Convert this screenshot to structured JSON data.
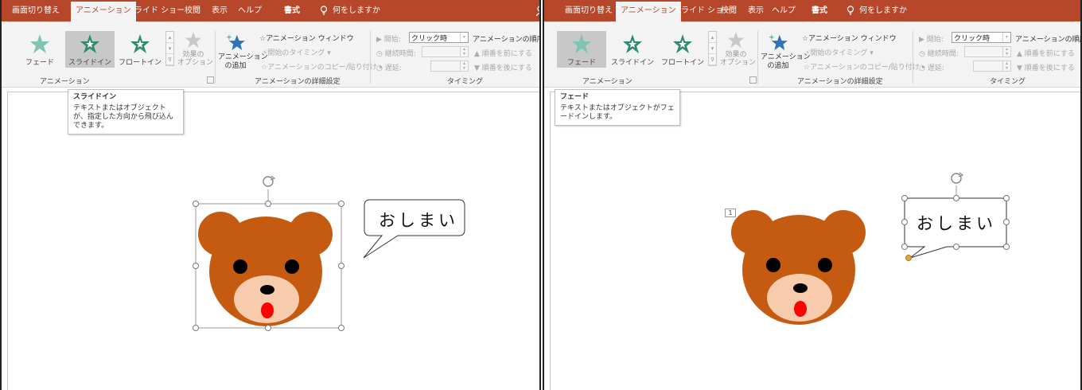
{
  "colors": {
    "accent": "#b7472a",
    "bear_fur": "#c55a11",
    "bear_muzzle": "#f8cbad",
    "tongue": "#ff0000"
  },
  "left": {
    "tabs": [
      "画面切り替え",
      "アニメーション",
      "スライド ショー",
      "校閲",
      "表示",
      "ヘルプ",
      "書式"
    ],
    "active_tab": "アニメーション",
    "tell_me": "何をしますか",
    "gallery": [
      "フェード",
      "スライドイン",
      "フロートイン"
    ],
    "selected_effect": "スライドイン",
    "effect_options": "効果の\nオプション",
    "group_animation": "アニメーション",
    "add_animation": "アニメーション\nの追加",
    "animation_pane": "アニメーション ウィンドウ",
    "trigger": "開始のタイミング",
    "painter": "アニメーションのコピー/貼り付け",
    "group_advanced": "アニメーションの詳細設定",
    "start_label": "開始:",
    "start_value": "クリック時",
    "duration_label": "継続時間:",
    "delay_label": "遅延:",
    "reorder_title": "アニメーションの順序変更",
    "move_earlier": "順番を前にする",
    "move_later": "順番を後にする",
    "group_timing": "タイミング",
    "tooltip_title": "スライドイン",
    "tooltip_desc": "テキストまたはオブジェクトが、指定した方向から飛び込んできます。",
    "bubble_text": "おしまい"
  },
  "right": {
    "tabs": [
      "画面切り替え",
      "アニメーション",
      "スライド ショー",
      "校閲",
      "表示",
      "ヘルプ",
      "書式"
    ],
    "active_tab": "アニメーション",
    "tell_me": "何をしますか",
    "gallery": [
      "フェード",
      "スライドイン",
      "フロートイン"
    ],
    "selected_effect": "フェード",
    "effect_options": "効果の\nオプション",
    "group_animation": "アニメーション",
    "add_animation": "アニメーション\nの追加",
    "animation_pane": "アニメーション ウィンドウ",
    "trigger": "開始のタイミング",
    "painter": "アニメーションのコピー/貼り付け",
    "group_advanced": "アニメーションの詳細設定",
    "start_label": "開始:",
    "start_value": "クリック時",
    "duration_label": "継続時間:",
    "delay_label": "遅延:",
    "reorder_title": "アニメーションの順序変更",
    "move_earlier": "順番を前にする",
    "move_later": "順番を後にする",
    "group_timing": "タイミング",
    "tooltip_title": "フェード",
    "tooltip_desc": "テキストまたはオブジェクトがフェードインします。",
    "bubble_text": "おしまい",
    "animation_order_tag": "1"
  }
}
